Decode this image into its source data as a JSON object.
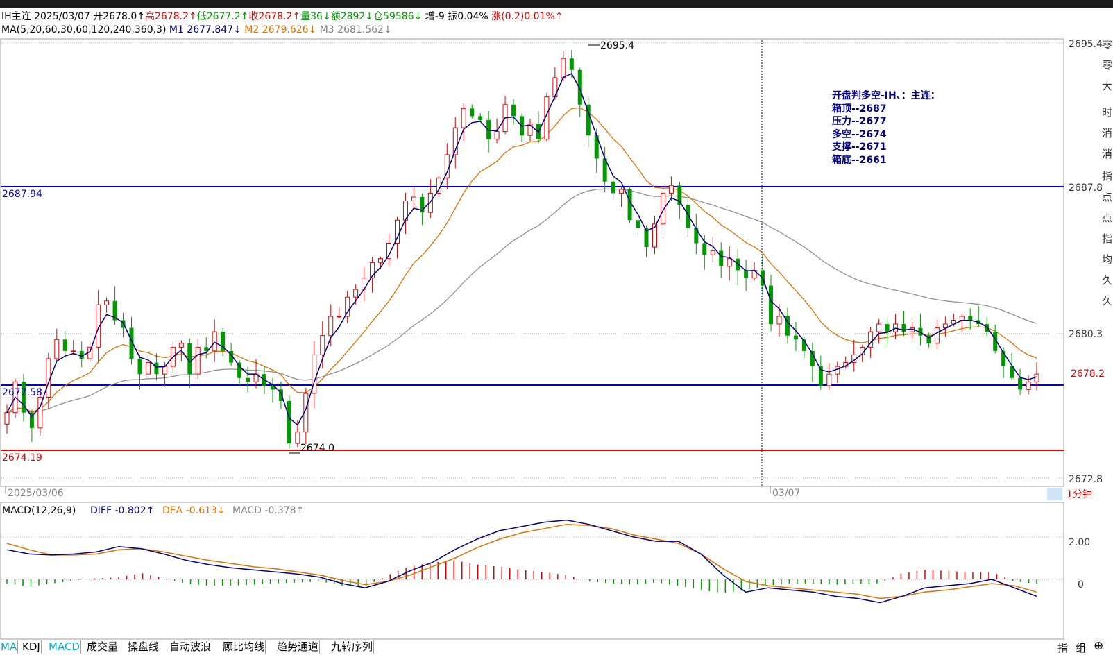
{
  "header": {
    "symbol": "IH主连",
    "date": "2025/03/07",
    "open": "开2678.0↑",
    "high": "高2678.2↑",
    "low": "低2677.2↑",
    "close": "收2678.2↑",
    "volume": "量36↓",
    "amount": "额2892↓",
    "oi": "仓59586↓",
    "oi_change": "增-9",
    "amplitude": "振0.04%",
    "change": "涨(0.2)0.01%↑"
  },
  "ma_legend": {
    "params": "MA(5,20,60,30,60,120,240,360,3)",
    "m1": "M1 2677.847↓",
    "m2": "M2 2679.626↓",
    "m3": "M3 2681.562↓"
  },
  "annotation": {
    "title": "开盘判多空-IH、：主连：",
    "lines": [
      "箱顶--2687",
      "压力--2677",
      "多空--2674",
      "支撑--2671",
      "箱底--2661"
    ]
  },
  "price_labels": {
    "right_ticks": [
      "2695.4",
      "2687.8",
      "2680.3",
      "2672.8"
    ],
    "current_price": "2678.2",
    "hline_top": "2687.94",
    "hline_mid": "2677.58",
    "hline_low": "2674.19",
    "peak_label": "2695.4",
    "trough_label": "2674.0",
    "date_left": "2025/03/06",
    "date_mid": "03/07",
    "period": "1分钟"
  },
  "macd_legend": {
    "params": "MACD(12,26,9)",
    "diff": "DIFF -0.802↑",
    "dea": "DEA -0.613↓",
    "macd": "MACD -0.378↑",
    "ticks": [
      "2.00",
      "0"
    ]
  },
  "bottom_tabs": [
    "MA",
    "KDJ",
    "MACD",
    "成交量",
    "操盘线",
    "自动波浪",
    "顾比均线",
    "趋势通道",
    "九转序列"
  ],
  "bottom_right": [
    "指",
    "组",
    "⊕"
  ],
  "right_panel_chars": [
    "零",
    "零",
    "大",
    "时",
    "消",
    "消",
    "指",
    "点",
    "点",
    "指",
    "均",
    "久",
    "久"
  ],
  "colors": {
    "up": "#e00000",
    "down": "#009a00",
    "m1": "#000080",
    "m2": "#e07000",
    "m3": "#909090",
    "hline_blue": "#0000c8",
    "hline_red": "#e00000"
  },
  "chart_data": {
    "type": "candlestick",
    "interval": "1分钟",
    "price_range": [
      2672.8,
      2695.4
    ],
    "horizontal_lines": [
      2687.94,
      2677.58,
      2674.19
    ],
    "key_points": {
      "high": 2695.4,
      "low": 2674.0,
      "last": 2678.2
    },
    "close_path": [
      2676.2,
      2677.8,
      2676.2,
      2675.4,
      2677.0,
      2679.0,
      2680.0,
      2679.4,
      2679.4,
      2679.0,
      2679.6,
      2681.8,
      2682.0,
      2681.0,
      2680.6,
      2679.0,
      2678.2,
      2678.8,
      2678.2,
      2678.6,
      2679.6,
      2679.8,
      2678.2,
      2679.6,
      2679.4,
      2680.4,
      2679.4,
      2678.8,
      2678.0,
      2677.8,
      2678.2,
      2677.6,
      2677.4,
      2676.8,
      2674.6,
      2675.2,
      2677.2,
      2679.2,
      2680.2,
      2681.2,
      2681.2,
      2682.2,
      2682.6,
      2683.2,
      2684.0,
      2684.2,
      2685.0,
      2686.2,
      2687.2,
      2687.4,
      2686.6,
      2687.6,
      2688.4,
      2689.6,
      2691.0,
      2692.0,
      2691.6,
      2691.4,
      2690.4,
      2690.8,
      2692.2,
      2691.6,
      2690.6,
      2691.2,
      2690.4,
      2692.6,
      2693.6,
      2694.6,
      2694.0,
      2692.2,
      2690.6,
      2689.4,
      2688.2,
      2687.6,
      2687.8,
      2686.2,
      2685.8,
      2684.8,
      2686.0,
      2687.6,
      2688.0,
      2687.0,
      2685.8,
      2685.0,
      2684.4,
      2684.6,
      2683.8,
      2684.2,
      2683.6,
      2683.2,
      2683.6,
      2682.8,
      2680.8,
      2681.2,
      2680.2,
      2680.0,
      2679.4,
      2678.6,
      2677.6,
      2678.2,
      2678.6,
      2678.8,
      2679.2,
      2679.6,
      2680.4,
      2680.8,
      2680.4,
      2680.8,
      2680.4,
      2680.6,
      2680.2,
      2679.8,
      2680.6,
      2680.8,
      2681.0,
      2681.2,
      2681.0,
      2680.8,
      2680.4,
      2679.4,
      2678.6,
      2678.0,
      2677.4,
      2677.8,
      2678.2
    ],
    "ma": [
      {
        "name": "M1",
        "last": 2677.847
      },
      {
        "name": "M2",
        "last": 2679.626
      },
      {
        "name": "M3",
        "last": 2681.562
      }
    ],
    "macd": {
      "range": [
        -1.2,
        3.0
      ],
      "ticks": [
        2.0,
        0
      ],
      "diff_last": -0.802,
      "dea_last": -0.613,
      "macd_last": -0.378,
      "diff": [
        1.4,
        1.2,
        1.15,
        1.2,
        1.3,
        1.55,
        1.45,
        1.2,
        0.9,
        0.7,
        0.55,
        0.45,
        0.35,
        0.25,
        0.1,
        -0.2,
        -0.4,
        -0.1,
        0.4,
        0.8,
        1.4,
        1.9,
        2.3,
        2.5,
        2.7,
        2.8,
        2.6,
        2.3,
        2.0,
        1.8,
        1.8,
        1.2,
        0.2,
        -0.6,
        -0.4,
        -0.5,
        -0.6,
        -0.8,
        -0.9,
        -1.1,
        -0.8,
        -0.4,
        -0.3,
        -0.2,
        0.0,
        -0.4,
        -0.8
      ],
      "dea": [
        1.7,
        1.4,
        1.15,
        1.15,
        1.2,
        1.4,
        1.45,
        1.3,
        1.1,
        0.9,
        0.75,
        0.6,
        0.5,
        0.35,
        0.2,
        -0.05,
        -0.25,
        -0.1,
        0.2,
        0.6,
        1.0,
        1.5,
        1.9,
        2.2,
        2.4,
        2.6,
        2.55,
        2.4,
        2.1,
        1.9,
        1.7,
        1.2,
        0.5,
        -0.1,
        -0.3,
        -0.4,
        -0.5,
        -0.6,
        -0.7,
        -0.9,
        -0.8,
        -0.6,
        -0.5,
        -0.35,
        -0.2,
        -0.3,
        -0.6
      ],
      "histogram": [
        -0.2,
        -0.35,
        -0.2,
        -0.05,
        0.05,
        0.1,
        0.3,
        0.05,
        -0.2,
        -0.3,
        -0.3,
        -0.25,
        -0.2,
        -0.15,
        -0.1,
        -0.3,
        -0.35,
        0.2,
        0.6,
        0.8,
        0.9,
        0.7,
        0.6,
        0.45,
        0.35,
        0.2,
        -0.1,
        -0.2,
        -0.25,
        -0.15,
        -0.3,
        -0.5,
        -0.65,
        -0.5,
        -0.3,
        -0.2,
        -0.2,
        -0.25,
        -0.2,
        -0.2,
        0.3,
        0.45,
        0.4,
        0.35,
        0.35,
        -0.1,
        -0.2
      ]
    }
  }
}
